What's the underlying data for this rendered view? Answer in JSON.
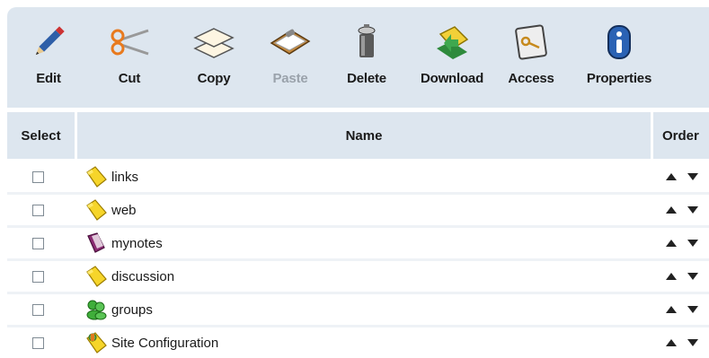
{
  "toolbar": {
    "buttons": [
      {
        "label": "Edit",
        "icon": "pencil-icon",
        "enabled": true
      },
      {
        "label": "Cut",
        "icon": "scissors-icon",
        "enabled": true
      },
      {
        "label": "Copy",
        "icon": "copy-icon",
        "enabled": true
      },
      {
        "label": "Paste",
        "icon": "clipboard-icon",
        "enabled": false
      },
      {
        "label": "Delete",
        "icon": "trash-can-icon",
        "enabled": true
      },
      {
        "label": "Download",
        "icon": "download-folder-icon",
        "enabled": true
      },
      {
        "label": "Access",
        "icon": "key-icon",
        "enabled": true
      },
      {
        "label": "Properties",
        "icon": "info-icon",
        "enabled": true
      }
    ]
  },
  "table": {
    "headers": {
      "select": "Select",
      "name": "Name",
      "order": "Order"
    },
    "rows": [
      {
        "name": "links",
        "icon": "folder-icon"
      },
      {
        "name": "web",
        "icon": "folder-icon"
      },
      {
        "name": "mynotes",
        "icon": "notebook-icon"
      },
      {
        "name": "discussion",
        "icon": "folder-icon"
      },
      {
        "name": "groups",
        "icon": "group-icon"
      },
      {
        "name": "Site Configuration",
        "icon": "config-folder-icon"
      }
    ]
  },
  "colors": {
    "header_bg": "#dde6ef",
    "row_separator": "#eef2f6",
    "disabled_text": "#9aa2ab"
  }
}
